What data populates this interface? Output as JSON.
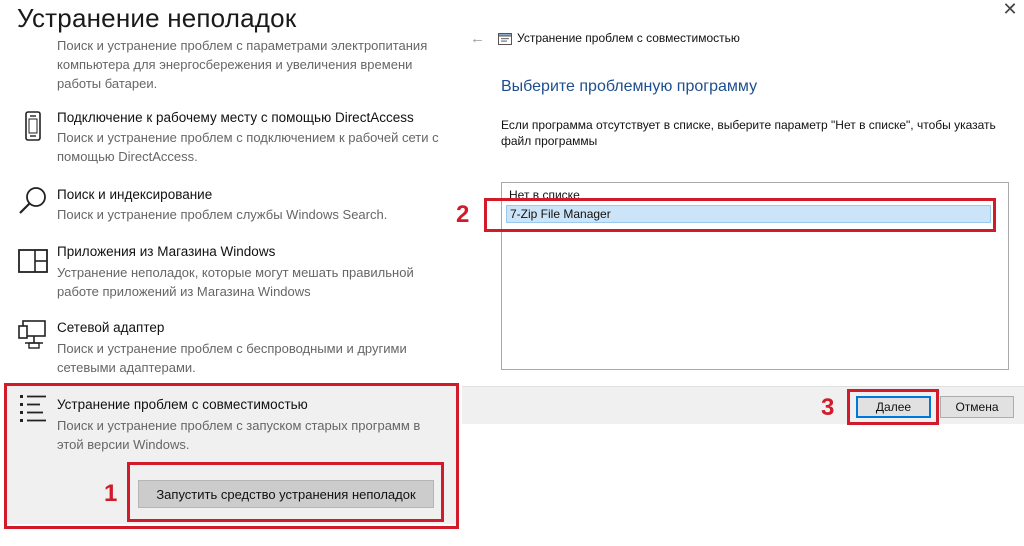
{
  "settings": {
    "title": "Устранение неполадок",
    "items": [
      {
        "name": "",
        "description": "Поиск и устранение проблем с параметрами электропитания компьютера для энергосбережения и увеличения  времени работы батареи."
      },
      {
        "name": "Подключение к рабочему месту с помощью DirectAccess",
        "description": "Поиск и устранение проблем с подключением к рабочей сети с помощью DirectAccess.",
        "icon": "phone-icon"
      },
      {
        "name": "Поиск и индексирование",
        "description": "Поиск и устранение проблем службы Windows Search.",
        "icon": "search-icon"
      },
      {
        "name": "Приложения из Магазина Windows",
        "description": "Устранение неполадок, которые могут мешать правильной работе приложений из Магазина Windows",
        "icon": "store-window-icon"
      },
      {
        "name": "Сетевой адаптер",
        "description": "Поиск и устранение проблем с беспроводными и другими сетевыми адаптерами.",
        "icon": "network-adapter-icon"
      },
      {
        "name": "Устранение проблем с совместимостью",
        "description": "Поиск и устранение проблем с запуском старых программ в этой версии Windows.",
        "icon": "compatibility-list-icon"
      }
    ],
    "run_button": "Запустить средство устранения неполадок"
  },
  "wizard": {
    "title": "Устранение проблем с совместимостью",
    "heading": "Выберите проблемную программу",
    "instruction": "Если программа отсутствует в списке, выберите параметр \"Нет в списке\", чтобы указать файл программы",
    "programs": [
      "Нет в списке",
      "7-Zip File Manager"
    ],
    "selected_index": 1,
    "next_button": "Далее",
    "cancel_button": "Отмена"
  },
  "annotations": {
    "markers": [
      "1",
      "2",
      "3"
    ],
    "color": "#d11a2a"
  },
  "colors": {
    "heading_blue": "#1e4f8f",
    "selection": "#cce4f7",
    "focus_border": "#0078d7",
    "panel_gray": "#f0f0f0"
  }
}
